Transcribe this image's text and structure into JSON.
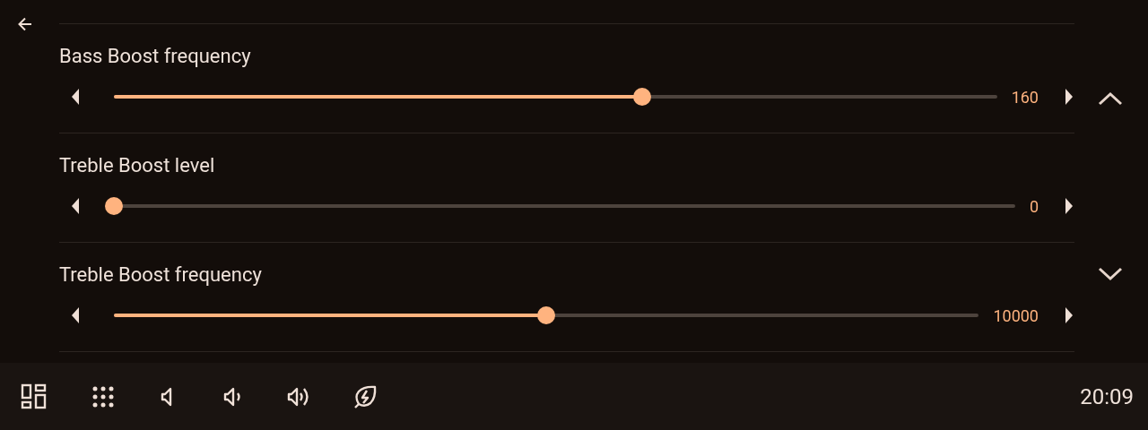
{
  "settings": [
    {
      "title": "Bass Boost frequency",
      "level": 0.598,
      "value": "160"
    },
    {
      "title": "Treble Boost level",
      "level": 0,
      "value": "0"
    },
    {
      "title": "Treble Boost frequency",
      "level": 0.5,
      "value": "10000"
    }
  ],
  "status_bar": {
    "clock": "20:09"
  }
}
